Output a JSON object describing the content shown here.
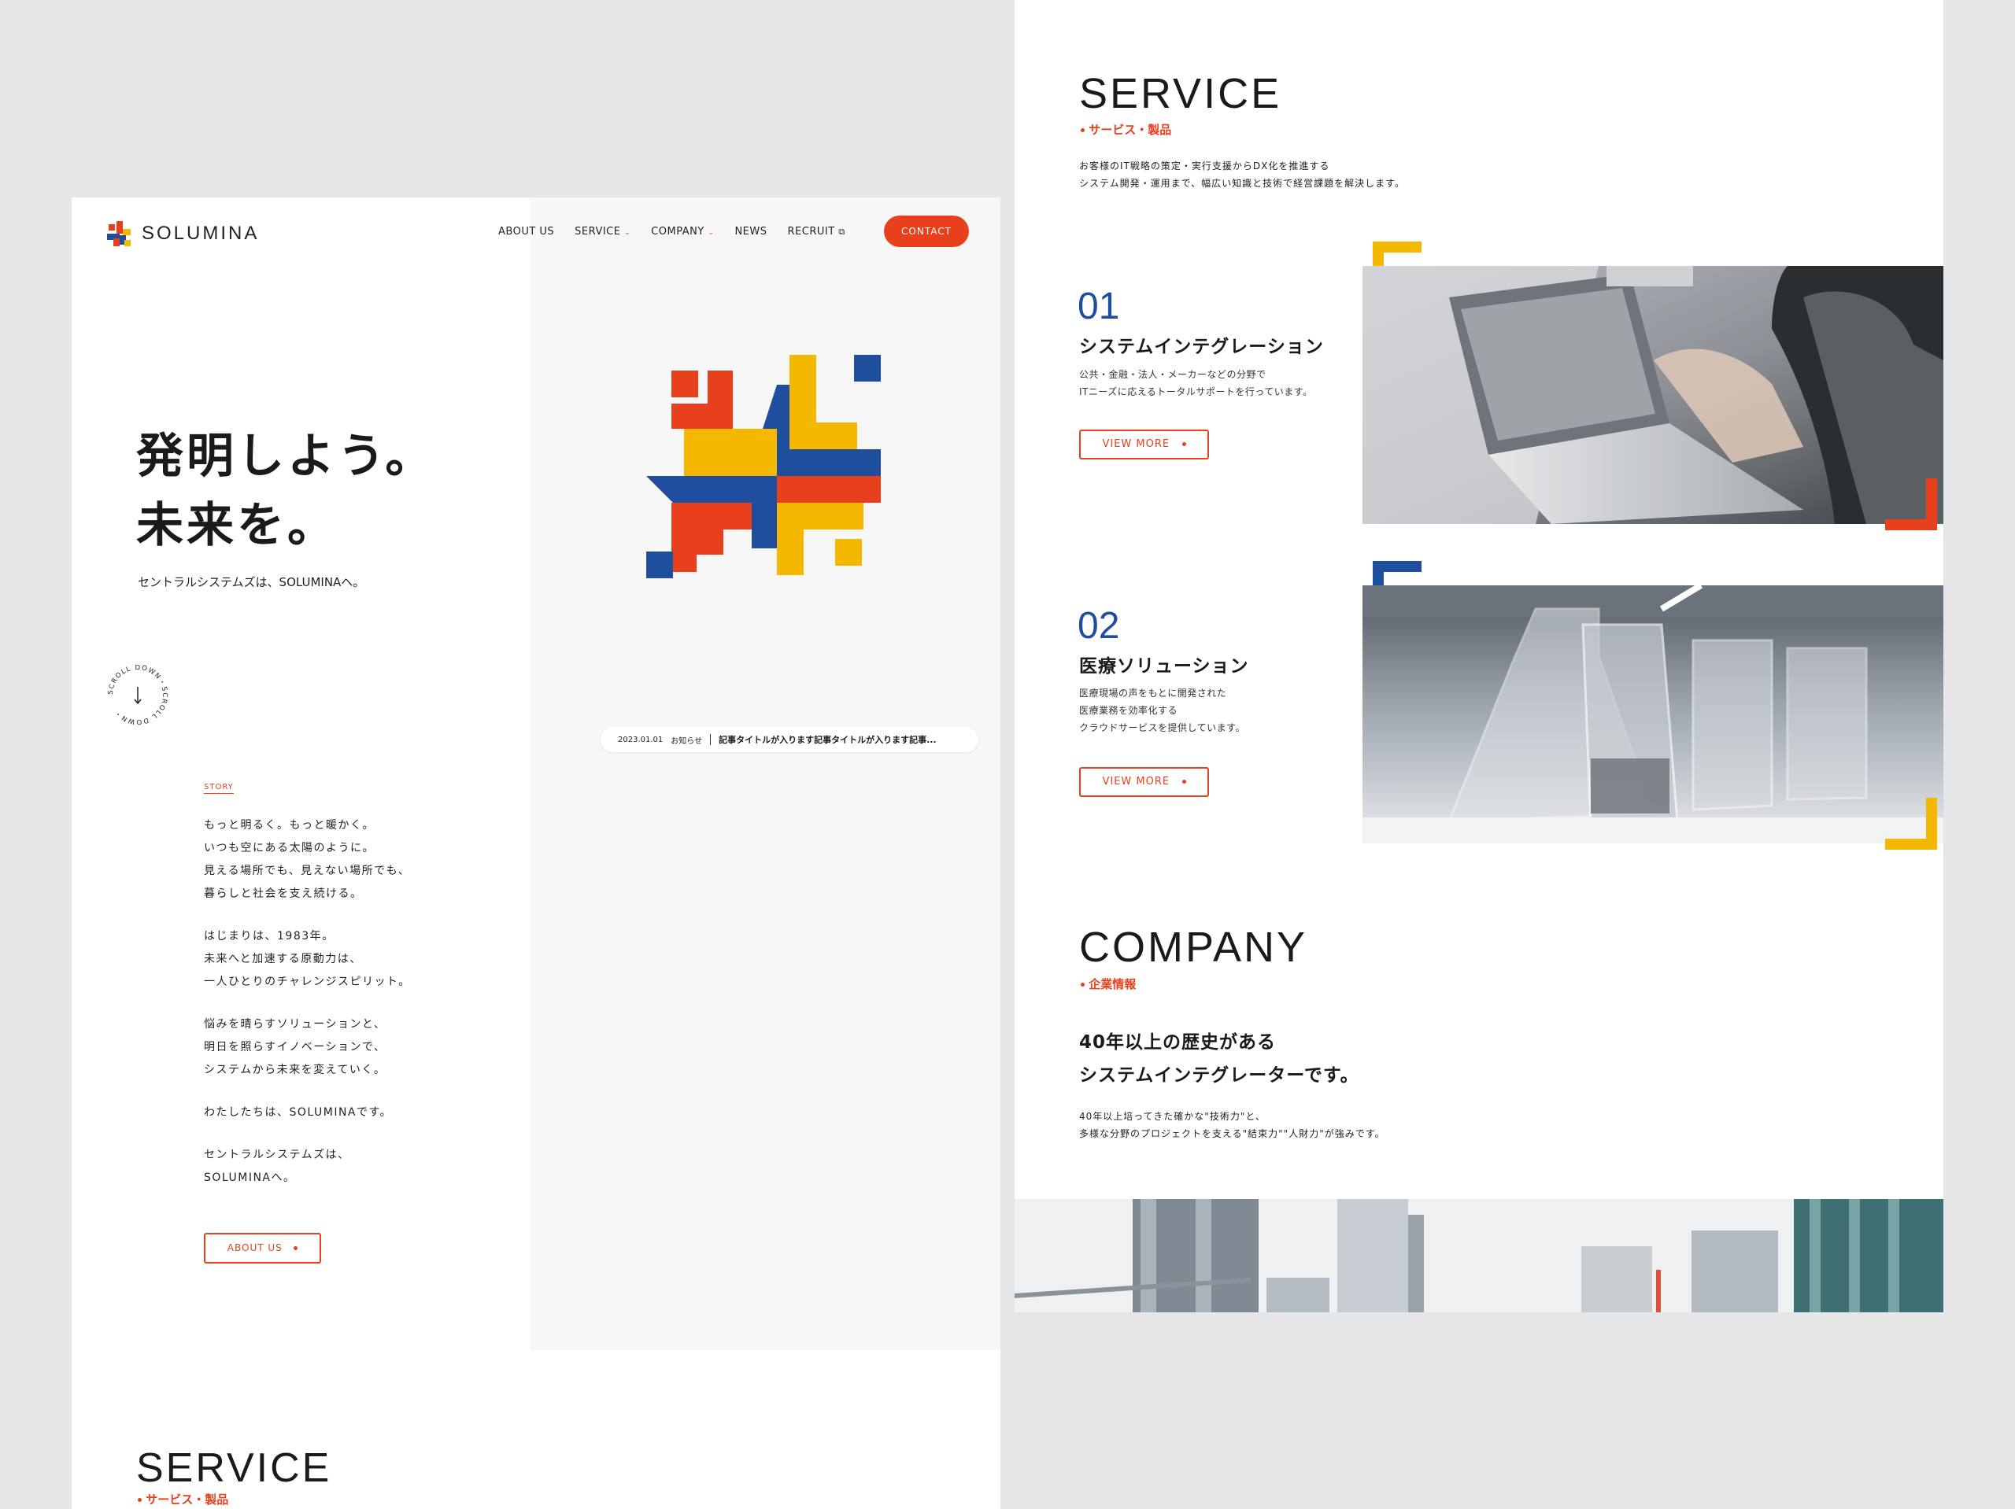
{
  "colors": {
    "accent": "#e8401c",
    "blue": "#1f4e9e",
    "yellow": "#f5b800"
  },
  "brand": {
    "name": "SOLUMINA"
  },
  "nav": {
    "items": [
      "ABOUT US",
      "SERVICE",
      "COMPANY",
      "NEWS",
      "RECRUIT"
    ],
    "contact": "CONTACT"
  },
  "hero": {
    "title_line1": "発明しよう。",
    "title_line2": "未来を。",
    "subtitle": "セントラルシステムズは、SOLUMINAへ。",
    "scroll_text": "SCROLL DOWN・SCROLL DOWN・"
  },
  "news": {
    "date": "2023.01.01",
    "category": "お知らせ",
    "title": "記事タイトルが入ります記事タイトルが入ります記事..."
  },
  "story": {
    "label": "STORY",
    "paragraphs": [
      [
        "もっと明るく。もっと暖かく。",
        "いつも空にある太陽のように。",
        "見える場所でも、見えない場所でも、",
        "暮らしと社会を支え続ける。"
      ],
      [
        "はじまりは、1983年。",
        "未来へと加速する原動力は、",
        "一人ひとりのチャレンジスピリット。"
      ],
      [
        "悩みを晴らすソリューションと、",
        "明日を照らすイノベーションで、",
        "システムから未来を変えていく。"
      ],
      [
        "わたしたちは、SOLUMINAです。"
      ],
      [
        "セントラルシステムズは、",
        "SOLUMINAへ。"
      ]
    ],
    "button": "ABOUT US"
  },
  "service": {
    "title": "SERVICE",
    "subtitle": "サービス・製品",
    "desc_line1": "お客様のIT戦略の策定・実行支援からDX化を推進する",
    "desc_line2": "システム開発・運用まで、幅広い知識と技術で経営課題を解決します。",
    "items": [
      {
        "num": "01",
        "name": "システムインテグレーション",
        "desc": [
          "公共・金融・法人・メーカーなどの分野で",
          "ITニーズに応えるトータルサポートを行っています。"
        ],
        "button": "VIEW MORE"
      },
      {
        "num": "02",
        "name": "医療ソリューション",
        "desc": [
          "医療現場の声をもとに開発された",
          "医療業務を効率化する",
          "クラウドサービスを提供しています。"
        ],
        "button": "VIEW MORE"
      }
    ]
  },
  "company": {
    "title": "COMPANY",
    "subtitle": "企業情報",
    "heading_line1": "40年以上の歴史がある",
    "heading_line2": "システムインテグレーターです。",
    "desc_line1": "40年以上培ってきた確かな\"技術力\"と、",
    "desc_line2": "多様な分野のプロジェクトを支える\"結束力\"\"人財力\"が強みです。"
  }
}
